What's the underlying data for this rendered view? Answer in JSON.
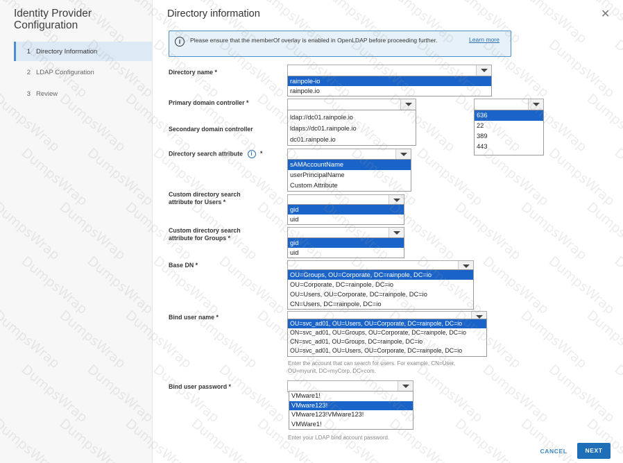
{
  "sidebar": {
    "title": "Identity Provider Configuration",
    "steps": [
      {
        "num": "1",
        "label": "Directory Information"
      },
      {
        "num": "2",
        "label": "LDAP Configuration"
      },
      {
        "num": "3",
        "label": "Review"
      }
    ]
  },
  "main": {
    "title": "Directory information",
    "info": {
      "text": "Please ensure that the memberOf overlay is enabled in OpenLDAP before proceeding further.",
      "link": "Learn more"
    },
    "fields": {
      "directory_name": {
        "label": "Directory name *",
        "options": [
          "rainpole-io",
          "rainpole.io"
        ]
      },
      "primary_dc": {
        "label": "Primary domain controller *"
      },
      "secondary_dc": {
        "label": "Secondary domain controller",
        "options": [
          "ldap://dc01.rainpole.io",
          "ldaps://dc01.rainpole.io",
          "dc01.rainpole.io"
        ]
      },
      "port": {
        "options": [
          "636",
          "22",
          "389",
          "443"
        ]
      },
      "search_attr": {
        "label": "Directory search attribute",
        "required": "*",
        "options": [
          "sAMAccountName",
          "userPrincipalName",
          "Custom Attribute"
        ]
      },
      "custom_users": {
        "label": "Custom directory search attribute for Users *",
        "options": [
          "gid",
          "uid"
        ]
      },
      "custom_groups": {
        "label": "Custom directory search attribute for Groups *",
        "options": [
          "gid",
          "uid"
        ]
      },
      "base_dn": {
        "label": "Base DN *",
        "options": [
          "OU=Groups, OU=Corporate, DC=rainpole, DC=io",
          "OU=Corporate, DC=rainpole, DC=io",
          "OU=Users, OU=Corporate, DC=rainpole, DC=io",
          "CN=Users, DC=rainpole, DC=io"
        ]
      },
      "bind_user": {
        "label": "Bind user name *",
        "options": [
          "OU=svc_ad01, OU=Users, OU=Corporate, DC=rainpole, DC=io",
          "ON=svc_ad01, OU=Groups, OU=Corporate, DC=rainpole, DC=io",
          "CN=svc_ad01, OU=Groups, DC=rainpole, DC=io",
          "OU=svc_ad01, OU=Users, OU=Corporate, DC=rainpole, DC=io"
        ],
        "hint": "Enter the account that can search for users. For example, CN=User, OU=myunit, DC=myCorp, DC=com."
      },
      "bind_password": {
        "label": "Bind user password *",
        "options": [
          "VMware1!",
          "VMware123!",
          "VMware123!VMware123!",
          "VMWare1!"
        ],
        "hint": "Enter your LDAP bind account password."
      }
    }
  },
  "footer": {
    "cancel": "CANCEL",
    "next": "NEXT"
  },
  "watermark": "DumpsWrap",
  "colors": {
    "accent": "#1f6fb8",
    "selected": "#1a64c9",
    "info_bg": "#e6f1f9"
  },
  "icons": {
    "close": "close-icon",
    "info": "info-icon",
    "dropdown": "chevron-down-icon"
  }
}
